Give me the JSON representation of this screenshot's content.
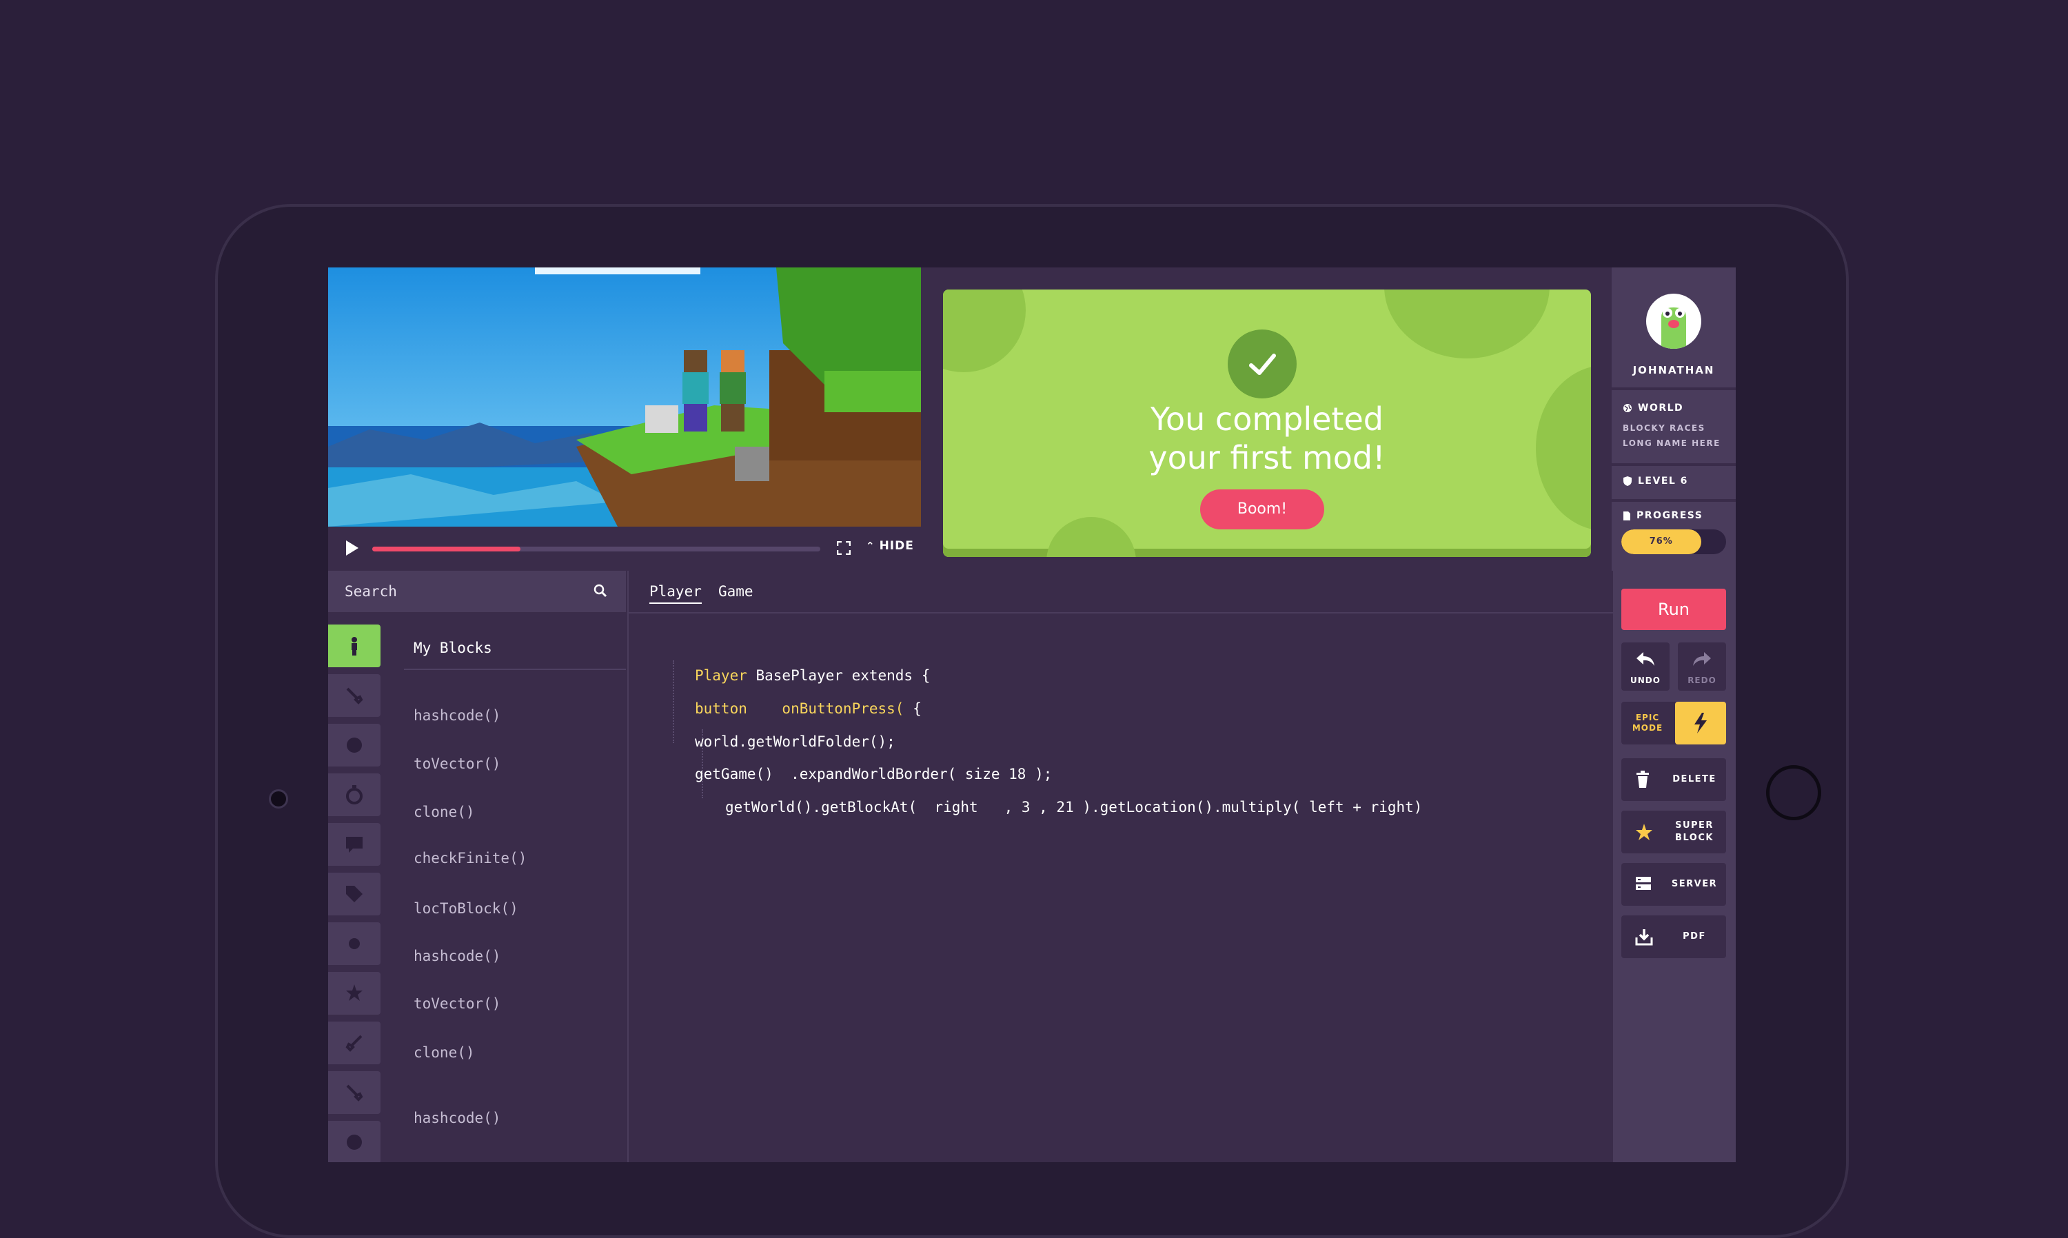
{
  "video": {
    "hide_label": "HIDE",
    "progress": 0.33
  },
  "success": {
    "title_line1": "You completed",
    "title_line2": "your first mod!",
    "button": "Boom!"
  },
  "user": {
    "name": "JOHNATHAN",
    "world_label": "WORLD",
    "world_name_line1": "BLOCKY RACES",
    "world_name_line2": "LONG NAME HERE",
    "level": "LEVEL 6",
    "progress_label": "PROGRESS",
    "progress_value": "76%",
    "progress_fraction": 0.76
  },
  "actions": {
    "run": "Run",
    "undo": "UNDO",
    "redo": "REDO",
    "epic_mode": "EPIC MODE",
    "delete": "DELETE",
    "super_block": "SUPER BLOCK",
    "server": "SERVER",
    "pdf": "PDF"
  },
  "palette": {
    "search_placeholder": "Search",
    "header": "My Blocks",
    "items": [
      "hashcode()",
      "toVector()",
      "clone()",
      "checkFinite()",
      "locToBlock()",
      "hashcode()",
      "toVector()",
      "clone()",
      "hashcode()"
    ]
  },
  "editor": {
    "tabs": [
      "Player",
      "Game"
    ],
    "line1_kw": "Player",
    "line1_rest": " BasePlayer extends {",
    "line2_kw": "button",
    "line2_fn": "    onButtonPress(",
    "line2_rest": " {",
    "line3": "world.getWorldFolder();",
    "line4": "getGame()  .expandWorldBorder( size 18 );",
    "line5": "getWorld().getBlockAt(  right   , 3 , 21 ).getLocation().multiply( left + right)"
  },
  "colors": {
    "accent": "#f04a6a",
    "success_green": "#a8d85c",
    "progress_yellow": "#f9c94a",
    "background": "#2b1f3a"
  }
}
